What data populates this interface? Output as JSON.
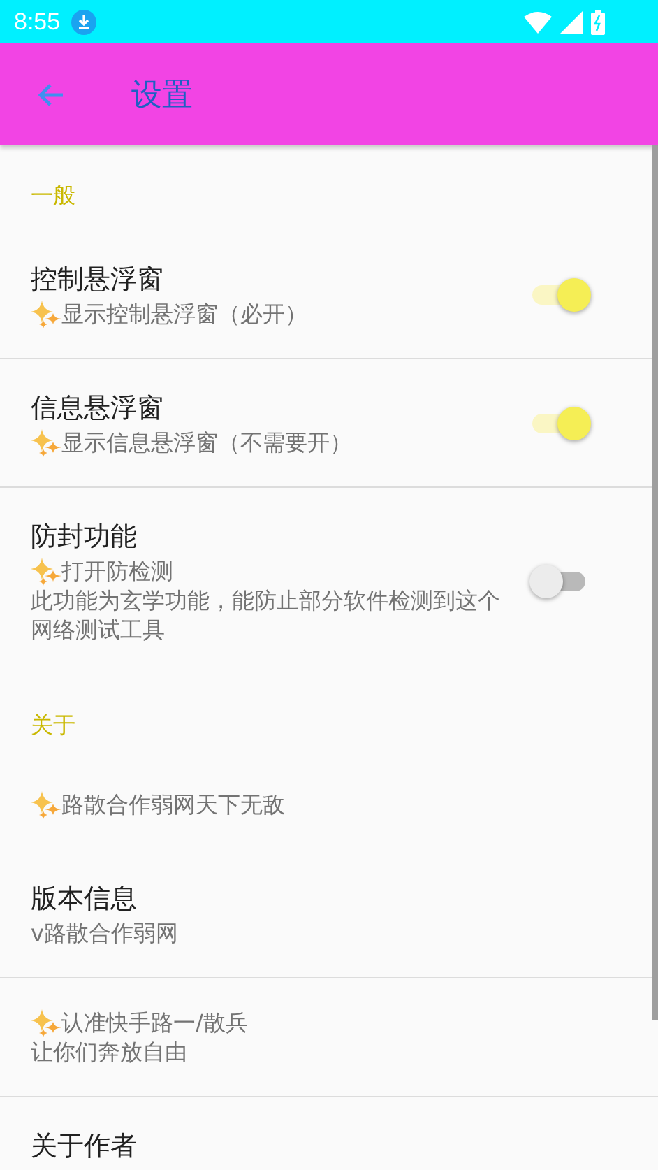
{
  "status_bar": {
    "time": "8:55"
  },
  "toolbar": {
    "title": "设置"
  },
  "sections": [
    {
      "header": "一般",
      "items": [
        {
          "kind": "switch",
          "title": "控制悬浮窗",
          "summary": "显示控制悬浮窗（必开）",
          "sparkle": true,
          "on": true,
          "divider": true
        },
        {
          "kind": "switch",
          "title": "信息悬浮窗",
          "summary": "显示信息悬浮窗（不需要开）",
          "sparkle": true,
          "on": true,
          "divider": true
        },
        {
          "kind": "switch",
          "title": "防封功能",
          "summary": "打开防检测",
          "sparkle": true,
          "note": "此功能为玄学功能，能防止部分软件检测到这个网络测试工具",
          "on": false,
          "divider": false
        }
      ]
    },
    {
      "header": "关于",
      "items": [
        {
          "kind": "text",
          "summary": "路散合作弱网天下无敌",
          "sparkle": true,
          "divider": false
        },
        {
          "kind": "text",
          "title": "版本信息",
          "summary": "v路散合作弱网",
          "sparkle": false,
          "divider": true
        },
        {
          "kind": "text",
          "summary": "认准快手路一/散兵",
          "sparkle": true,
          "note": "让你们奔放自由",
          "divider": true
        },
        {
          "kind": "text",
          "title": "关于作者"
        }
      ]
    }
  ]
}
